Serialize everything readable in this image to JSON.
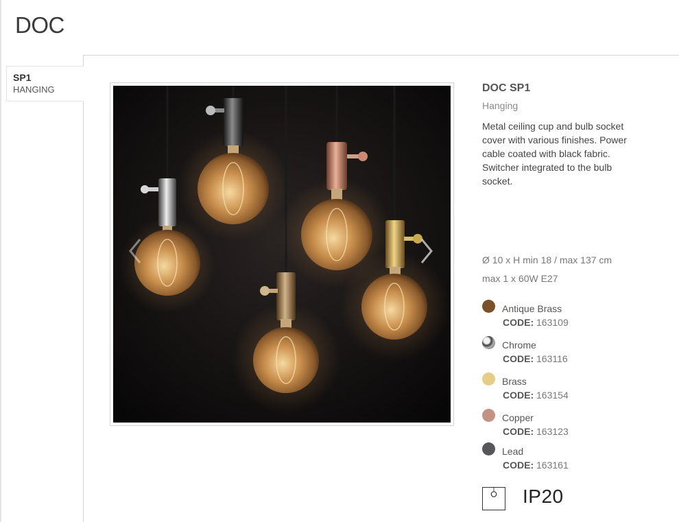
{
  "page": {
    "title": "DOC"
  },
  "sidebar": {
    "tabs": [
      {
        "code": "SP1",
        "sub": "HANGING"
      }
    ]
  },
  "product": {
    "name": "DOC SP1",
    "type": "Hanging",
    "description": "Metal ceiling cup and bulb socket cover with various finishes. Power cable coated with black fabric. Switcher integrated to the bulb socket.",
    "dimensions": "Ø 10 x H min 18 / max 137 cm",
    "power": "max 1 x 60W E27",
    "code_label": "CODE:",
    "finishes": [
      {
        "name": "Antique Brass",
        "code": "163109",
        "color": "#7a5128"
      },
      {
        "name": "Chrome",
        "code": "163116",
        "color": "#3c3c3c"
      },
      {
        "name": "Brass",
        "code": "163154",
        "color": "#e6cd87"
      },
      {
        "name": "Copper",
        "code": "163123",
        "color": "#c49282"
      },
      {
        "name": "Lead",
        "code": "163161",
        "color": "#55575b"
      }
    ],
    "ip_rating": "IP20"
  },
  "gallery": {
    "prev_icon": "chevron-left-icon",
    "next_icon": "chevron-right-icon"
  }
}
